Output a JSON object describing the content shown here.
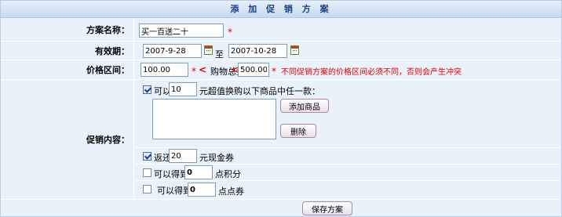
{
  "form": {
    "title": "添 加 促 销 方 案",
    "name": {
      "label": "方案名称：",
      "value": "买一百送二十",
      "required": "*"
    },
    "validity": {
      "label": "有效期：",
      "start": "2007-9-28",
      "separator": "至",
      "end": "2007-10-28"
    },
    "price_range": {
      "label": "价格区间：",
      "min": "100.00",
      "required_mark": "*",
      "lt1": "<",
      "middle": "购物总金额",
      "lt2": "<",
      "max": "500.00",
      "hint_mark": "*",
      "hint": "不同促销方案的价格区间必须不同，否则会产生冲突"
    },
    "promotion": {
      "label": "促销内容：",
      "option1": {
        "prefix": "可以",
        "value": "10",
        "suffix": "元超值换购以下商品中任一款：",
        "checked": true
      },
      "add_product_button": "添加商品",
      "delete_button": "删除",
      "option2": {
        "prefix": "返还",
        "value": "20",
        "suffix": "元现金券",
        "checked": true
      },
      "option3": {
        "prefix": "可以得到",
        "value": "0",
        "suffix": "点积分",
        "checked": false
      },
      "option4": {
        "prefix": "可以得到",
        "value": "0",
        "suffix": "点点券",
        "checked": false
      }
    },
    "save_button": "保存方案"
  },
  "colors": {
    "title_text": "#1b3e83",
    "panel_bg": "#e9f1fa",
    "required": "#e60000"
  }
}
